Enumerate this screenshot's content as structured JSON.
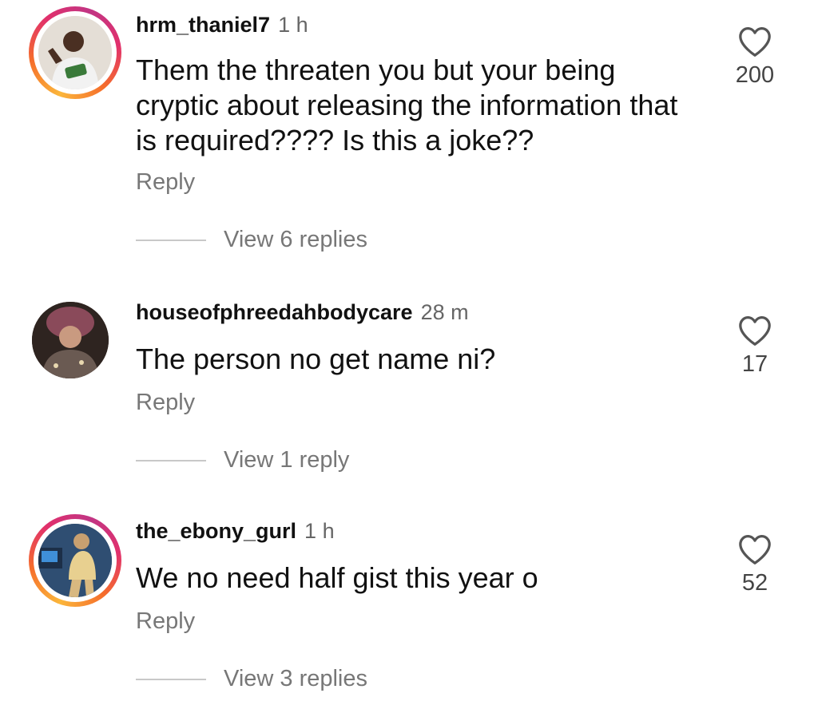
{
  "comments": [
    {
      "username": "hrm_thaniel7",
      "time": "1 h",
      "text_lines": [
        "Them the threaten you but your being",
        "cryptic about releasing the information that",
        "is required???? Is this a joke??"
      ],
      "reply_label": "Reply",
      "view_replies": "View 6 replies",
      "likes": "200",
      "avatar_ring": true
    },
    {
      "username": "houseofphreedahbodycare",
      "time": "28 m",
      "text_lines": [
        "The person no get name ni?"
      ],
      "reply_label": "Reply",
      "view_replies": "View 1 reply",
      "likes": "17",
      "avatar_ring": false
    },
    {
      "username": "the_ebony_gurl",
      "time": "1 h",
      "text_lines": [
        "We no need half gist this year o"
      ],
      "reply_label": "Reply",
      "view_replies": "View 3 replies",
      "likes": "52",
      "avatar_ring": true
    }
  ],
  "colors": {
    "text": "#111111",
    "muted": "#777777",
    "ring_start": "#fbb63b",
    "ring_mid": "#e1306c",
    "ring_end": "#c13584"
  },
  "icons": {
    "like": "heart-outline-icon"
  }
}
